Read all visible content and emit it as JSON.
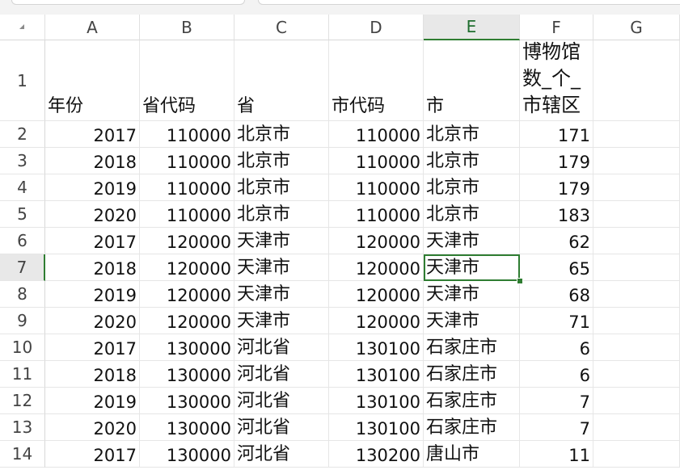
{
  "columns": [
    "A",
    "B",
    "C",
    "D",
    "E",
    "F",
    "G"
  ],
  "selected_cell": {
    "column": "E",
    "row": "7"
  },
  "header_row": {
    "row_number": "1",
    "cells": [
      "年份",
      "省代码",
      "省",
      "市代码",
      "市",
      "博物馆数_个_市辖区"
    ]
  },
  "rows": [
    {
      "n": "2",
      "a": "2017",
      "b": "110000",
      "c": "北京市",
      "d": "110000",
      "e": "北京市",
      "f": "171"
    },
    {
      "n": "3",
      "a": "2018",
      "b": "110000",
      "c": "北京市",
      "d": "110000",
      "e": "北京市",
      "f": "179"
    },
    {
      "n": "4",
      "a": "2019",
      "b": "110000",
      "c": "北京市",
      "d": "110000",
      "e": "北京市",
      "f": "179"
    },
    {
      "n": "5",
      "a": "2020",
      "b": "110000",
      "c": "北京市",
      "d": "110000",
      "e": "北京市",
      "f": "183"
    },
    {
      "n": "6",
      "a": "2017",
      "b": "120000",
      "c": "天津市",
      "d": "120000",
      "e": "天津市",
      "f": "62"
    },
    {
      "n": "7",
      "a": "2018",
      "b": "120000",
      "c": "天津市",
      "d": "120000",
      "e": "天津市",
      "f": "65"
    },
    {
      "n": "8",
      "a": "2019",
      "b": "120000",
      "c": "天津市",
      "d": "120000",
      "e": "天津市",
      "f": "68"
    },
    {
      "n": "9",
      "a": "2020",
      "b": "120000",
      "c": "天津市",
      "d": "120000",
      "e": "天津市",
      "f": "71"
    },
    {
      "n": "10",
      "a": "2017",
      "b": "130000",
      "c": "河北省",
      "d": "130100",
      "e": "石家庄市",
      "f": "6"
    },
    {
      "n": "11",
      "a": "2018",
      "b": "130000",
      "c": "河北省",
      "d": "130100",
      "e": "石家庄市",
      "f": "6"
    },
    {
      "n": "12",
      "a": "2019",
      "b": "130000",
      "c": "河北省",
      "d": "130100",
      "e": "石家庄市",
      "f": "7"
    },
    {
      "n": "13",
      "a": "2020",
      "b": "130000",
      "c": "河北省",
      "d": "130100",
      "e": "石家庄市",
      "f": "7"
    },
    {
      "n": "14",
      "a": "2017",
      "b": "130000",
      "c": "河北省",
      "d": "130200",
      "e": "唐山市",
      "f": "11"
    }
  ],
  "colors": {
    "selection": "#2f7d32",
    "header_bg": "#e8e8e8",
    "grid": "#e6e6e6"
  }
}
